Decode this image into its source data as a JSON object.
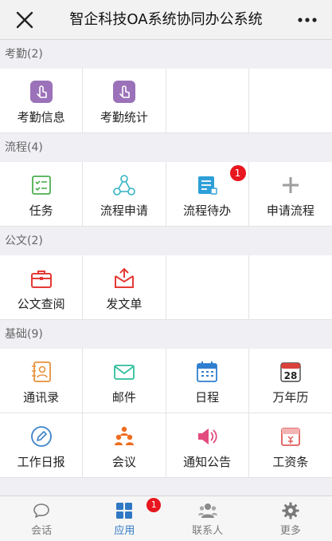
{
  "header": {
    "title": "智企科技OA系统协同办公系统",
    "close_icon": "close-icon",
    "more_icon": "more-dots-icon"
  },
  "sections": [
    {
      "title": "考勤(2)",
      "items": [
        {
          "label": "考勤信息",
          "icon": "tap-hand-icon",
          "color": "#9b72b9"
        },
        {
          "label": "考勤统计",
          "icon": "tap-hand-icon",
          "color": "#9b72b9"
        }
      ]
    },
    {
      "title": "流程(4)",
      "items": [
        {
          "label": "任务",
          "icon": "checklist-icon",
          "color": "#4caf50"
        },
        {
          "label": "流程申请",
          "icon": "flow-nodes-icon",
          "color": "#35b3c3"
        },
        {
          "label": "流程待办",
          "icon": "todo-list-icon",
          "color": "#2e9fd8",
          "badge": "1"
        },
        {
          "label": "申请流程",
          "icon": "plus-icon",
          "color": "#9e9e9e"
        }
      ]
    },
    {
      "title": "公文(2)",
      "items": [
        {
          "label": "公文查阅",
          "icon": "briefcase-icon",
          "color": "#e53935"
        },
        {
          "label": "发文单",
          "icon": "send-doc-icon",
          "color": "#e53935"
        }
      ]
    },
    {
      "title": "基础(9)",
      "items": [
        {
          "label": "通讯录",
          "icon": "contact-card-icon",
          "color": "#e8913a"
        },
        {
          "label": "邮件",
          "icon": "mail-icon",
          "color": "#2fbf9c"
        },
        {
          "label": "日程",
          "icon": "calendar-icon",
          "color": "#2f7fd0"
        },
        {
          "label": "万年历",
          "icon": "calendar-28-icon",
          "color": "#d9413a",
          "icon_text": "28"
        },
        {
          "label": "工作日报",
          "icon": "pencil-icon",
          "color": "#3d84c9"
        },
        {
          "label": "会议",
          "icon": "meeting-people-icon",
          "color": "#ef6d1f"
        },
        {
          "label": "通知公告",
          "icon": "speaker-icon",
          "color": "#e24b7d"
        },
        {
          "label": "工资条",
          "icon": "salary-slip-icon",
          "color": "#e05b5b"
        }
      ]
    }
  ],
  "tabs": [
    {
      "label": "会话",
      "icon": "chat-bubble-icon",
      "active": false
    },
    {
      "label": "应用",
      "icon": "apps-grid-icon",
      "active": true,
      "badge": "1"
    },
    {
      "label": "联系人",
      "icon": "contacts-icon",
      "active": false
    },
    {
      "label": "更多",
      "icon": "gear-icon",
      "active": false
    }
  ],
  "colors": {
    "accent": "#2f78c4",
    "badge": "#e8161e"
  }
}
